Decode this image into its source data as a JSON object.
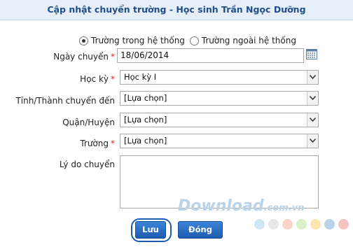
{
  "dialog": {
    "title": "Cập nhật chuyển trường - Học sinh Trần Ngọc Dưỡng"
  },
  "school_type": {
    "option_internal": "Trường trong hệ thống",
    "option_external": "Trường ngoài hệ thống",
    "selected": "internal"
  },
  "form": {
    "transfer_date_label": "Ngày chuyển",
    "transfer_date_value": "18/06/2014",
    "semester_label": "Học kỳ",
    "semester_value": "Học kỳ I",
    "province_label": "Tỉnh/Thành chuyển đến",
    "province_value": "[Lựa chọn]",
    "district_label": "Quận/Huyện",
    "district_value": "[Lựa chọn]",
    "school_label": "Trường",
    "school_value": "[Lựa chọn]",
    "reason_label": "Lý do chuyển",
    "reason_value": "",
    "required_mark": "*"
  },
  "buttons": {
    "save_label": "Lưu",
    "close_label": "Đóng"
  },
  "watermark": {
    "text": "Download",
    "suffix": ".com.vn"
  },
  "colors": {
    "title": "#1f4e8c",
    "button": "#1c5cb0",
    "required": "#d22222",
    "dots": [
      "#cfe6f5",
      "#e7e7e7",
      "#fbd3c8",
      "#d9f0c8",
      "#fde6b0",
      "#b9d4ea",
      "#f6c2c2"
    ]
  }
}
